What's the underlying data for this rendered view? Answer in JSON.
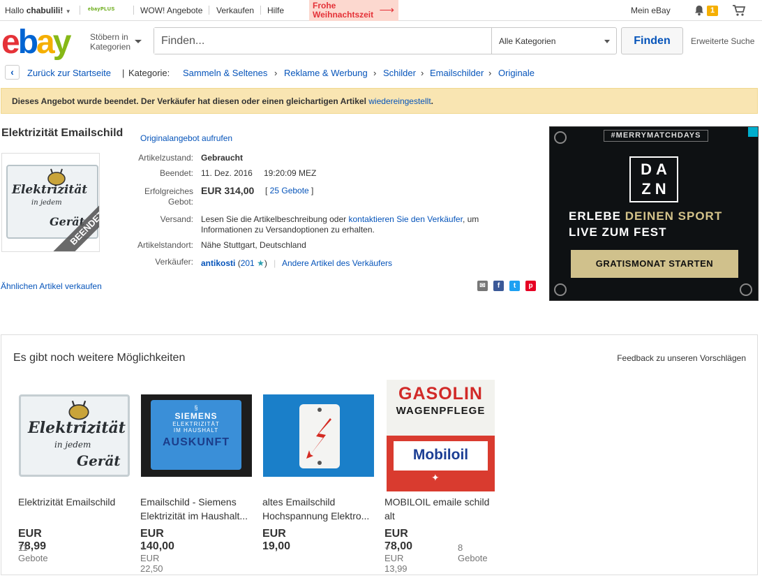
{
  "topbar": {
    "greeting": "Hallo",
    "username": "chabulili!",
    "ebayplus": "ebayPLUS",
    "wow": "WOW! Angebote",
    "sell": "Verkaufen",
    "help": "Hilfe",
    "xmas": "Frohe Weihnachtszeit",
    "my_ebay": "Mein eBay",
    "notif_count": "1"
  },
  "header": {
    "logo": [
      "e",
      "b",
      "a",
      "y"
    ],
    "browse": "Stöbern in Kategorien",
    "search_placeholder": "Finden...",
    "category": "Alle Kategorien",
    "find": "Finden",
    "advanced": "Erweiterte Suche"
  },
  "breadcrumb": {
    "back": "Zurück zur Startseite",
    "category_label": "Kategorie:",
    "items": [
      "Sammeln & Seltenes",
      "Reklame & Werbung",
      "Schilder",
      "Emailschilder",
      "Originale"
    ]
  },
  "notice": {
    "text": "Dieses Angebot wurde beendet. Der Verkäufer hat diesen oder einen gleichartigen Artikel",
    "link": "wiedereingestellt",
    "end": "."
  },
  "listing": {
    "title": "Elektrizität Emailschild",
    "original_link": "Originalangebot aufrufen",
    "ended_badge": "BEENDET",
    "thumb_text_1": "Elektrizität",
    "thumb_text_2": "in jedem",
    "thumb_text_3": "Gerät",
    "condition_label": "Artikelzustand:",
    "condition": "Gebraucht",
    "ended_label": "Beendet:",
    "ended_date": "11. Dez. 2016",
    "ended_time": "19:20:09 MEZ",
    "winning_label": "Erfolgreiches Gebot:",
    "price": "EUR 314,00",
    "bids": "25 Gebote",
    "shipping_label": "Versand:",
    "shipping_1": "Lesen Sie die Artikelbeschreibung oder",
    "shipping_link": "kontaktieren Sie den Verkäufer",
    "shipping_2": ", um Informationen zu Versandoptionen zu erhalten.",
    "location_label": "Artikelstandort:",
    "location": "Nähe Stuttgart, Deutschland",
    "seller_label": "Verkäufer:",
    "seller": "antikosti",
    "seller_score": "201",
    "other_items": "Andere Artikel des Verkäufers",
    "sell_similar": "Ähnlichen Artikel verkaufen"
  },
  "ad": {
    "tag": "#MERRYMATCHDAYS",
    "brand_1": "DA",
    "brand_2": "ZN",
    "line1_a": "ERLEBE",
    "line1_b": "DEINEN SPORT",
    "line2": "LIVE ZUM FEST",
    "cta": "GRATISMONAT STARTEN"
  },
  "recommendations": {
    "heading": "Es gibt noch weitere Möglichkeiten",
    "feedback": "Feedback zu unseren Vorschlägen",
    "items": [
      {
        "name": "Elektrizität Emailschild",
        "price": "EUR 78,99",
        "sub": "11 Gebote",
        "bids": ""
      },
      {
        "name": "Emailschild - Siemens Elektrizität im Haushalt...",
        "price": "EUR 140,00",
        "sub": "+ EUR 22,50",
        "bids": "",
        "img_1": "SIEMENS",
        "img_2": "ELEKTRIZITÄT",
        "img_3": "IM HAUSHALT",
        "img_4": "AUSKUNFT"
      },
      {
        "name": "altes Emailschild Hochspannung Elektro...",
        "price": "EUR 19,00",
        "sub": "",
        "bids": ""
      },
      {
        "name": "MOBILOIL emaile schild alt",
        "price": "EUR 78,00",
        "sub": "+ EUR 13,99",
        "bids": "8 Gebote",
        "img_1": "GASOLIN",
        "img_2": "WAGENPFLEGE",
        "img_3": "Mobiloil"
      }
    ]
  }
}
